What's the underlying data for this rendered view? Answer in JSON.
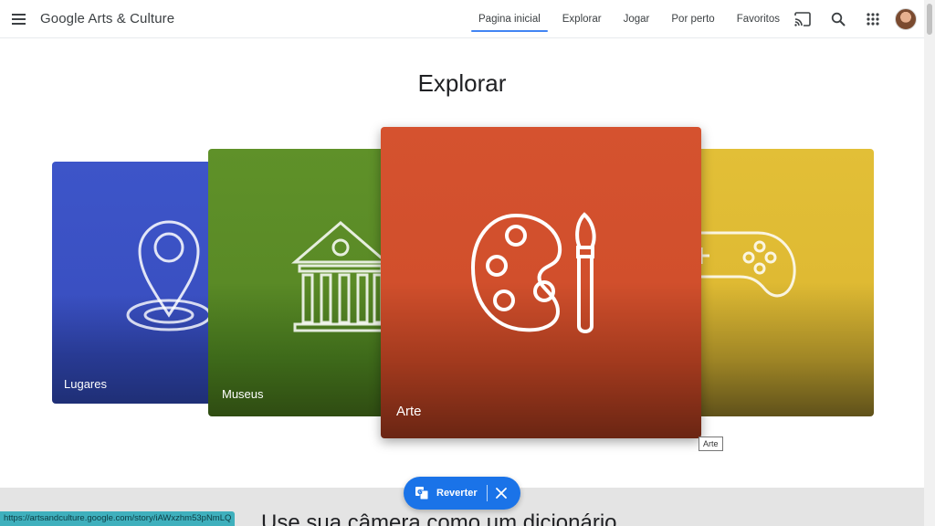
{
  "header": {
    "logo": "Google Arts & Culture",
    "nav": [
      {
        "label": "Pagina inicial",
        "active": true
      },
      {
        "label": "Explorar",
        "active": false
      },
      {
        "label": "Jogar",
        "active": false
      },
      {
        "label": "Por perto",
        "active": false
      },
      {
        "label": "Favoritos",
        "active": false
      }
    ],
    "icons": [
      "menu-icon",
      "cast-icon",
      "search-icon",
      "apps-icon",
      "avatar"
    ]
  },
  "main": {
    "title": "Explorar",
    "cards": [
      {
        "label": "Lugares",
        "color": "#3d55c9",
        "icon": "map-pin-icon"
      },
      {
        "label": "Museus",
        "color": "#5f9129",
        "icon": "museum-icon"
      },
      {
        "label": "Arte",
        "color": "#d5522f",
        "icon": "palette-icon"
      },
      {
        "label": "",
        "color": "#e2bf37",
        "icon": "gamepad-icon"
      }
    ],
    "tooltip": "Arte"
  },
  "next_section": {
    "title": "Use sua câmera como um dicionário"
  },
  "translate_bar": {
    "label": "Reverter",
    "color": "#1a73e8"
  },
  "status_url": "https://artsandculture.google.com/story/iAWxzhm53pNmLQ"
}
